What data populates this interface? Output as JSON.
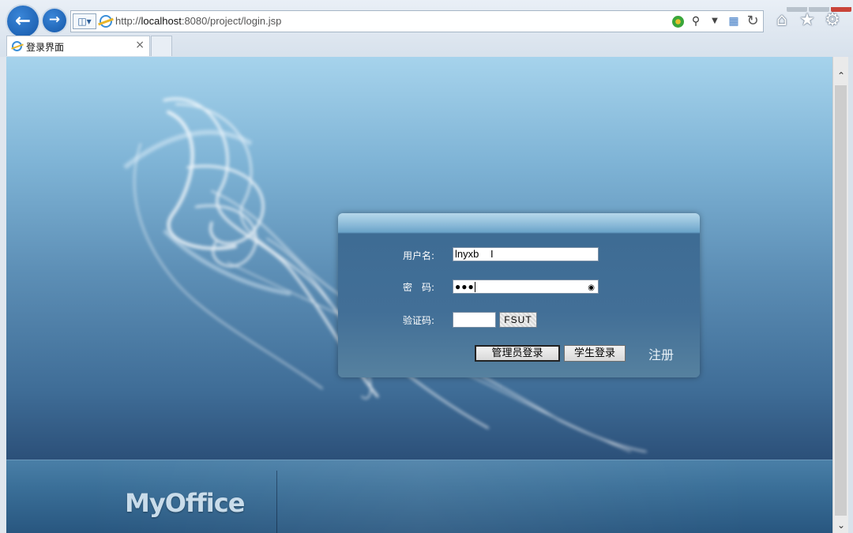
{
  "browser": {
    "url_prefix": "http://",
    "url_host": "localhost",
    "url_rest": ":8080/project/login.jsp",
    "tab_title": "登录界面",
    "tab_close": "×",
    "icons": {
      "back": "back-arrow-icon",
      "forward": "forward-arrow-icon",
      "compat": "compatibility-shield-icon",
      "home": "home-icon",
      "favorites": "star-icon",
      "settings": "gear-icon"
    }
  },
  "login": {
    "username_label": "用户名:",
    "username_value": "lnyxb",
    "password_label": "密　码:",
    "password_value": "●●●",
    "captcha_label": "验证码:",
    "captcha_value": "",
    "captcha_text": "FSUT",
    "admin_login": "管理员登录",
    "student_login": "学生登录",
    "register": "注册"
  },
  "footer": {
    "brand": "MyOffice"
  },
  "colors": {
    "panel_bg": "#426f97",
    "page_top": "#a6d3ec",
    "page_bottom": "#274a70"
  }
}
